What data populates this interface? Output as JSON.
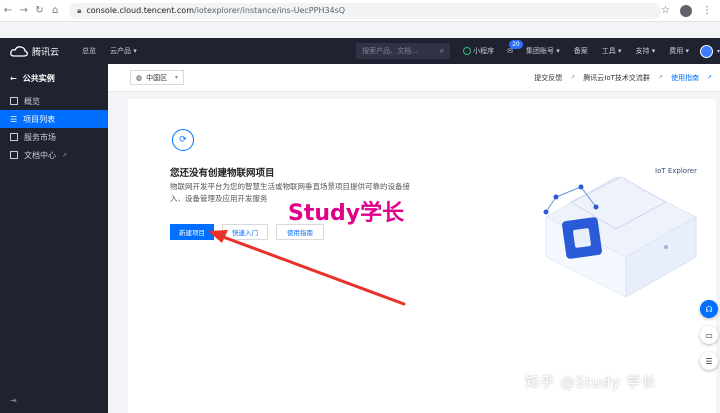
{
  "browser": {
    "url_host": "console.cloud.tencent.com",
    "url_path": "/iotexplorer/instance/ins-UecPPH34sQ"
  },
  "topnav": {
    "brand": "腾讯云",
    "overview": "总览",
    "products": "云产品 ▾",
    "search_placeholder": "搜索产品、文档...",
    "mini_program": "小程序",
    "mail_badge": "20",
    "account": "集团账号 ▾",
    "record": "备案",
    "tools": "工具 ▾",
    "support": "支持 ▾",
    "billing": "费用 ▾"
  },
  "sidebar": {
    "back_title": "公共实例",
    "items": [
      {
        "label": "概览"
      },
      {
        "label": "项目列表"
      },
      {
        "label": "服务市场"
      },
      {
        "label": "文档中心"
      }
    ]
  },
  "subbar": {
    "region": "中国区",
    "links": [
      "提交反馈",
      "腾讯云IoT技术交流群",
      "使用指南"
    ]
  },
  "empty": {
    "title": "您还没有创建物联网项目",
    "description": "物联网开发平台为您的智慧生活或物联网垂直场景项目提供可靠的设备接入、设备管理及应用开发服务",
    "btn_create": "新建项目",
    "btn_quick": "快速入门",
    "btn_guide": "使用指南"
  },
  "watermark": "Study学长",
  "illustration_label": "IoT Explorer",
  "zhihu_watermark": "知乎 @Study 学长",
  "colors": {
    "accent": "#006eff",
    "nav_bg": "#1f2230",
    "sidebar_bg": "#20232f",
    "annotation": "#e8322b"
  }
}
